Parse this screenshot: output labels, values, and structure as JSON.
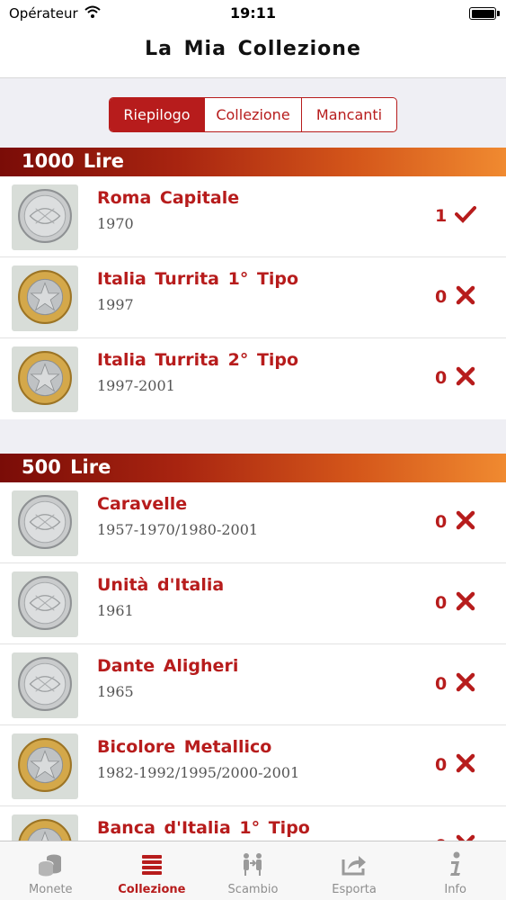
{
  "status_bar": {
    "carrier": "Opérateur",
    "time": "19:11"
  },
  "nav": {
    "title": "La Mia Collezione"
  },
  "segments": [
    {
      "label": "Riepilogo",
      "active": true
    },
    {
      "label": "Collezione",
      "active": false
    },
    {
      "label": "Mancanti",
      "active": false
    }
  ],
  "sections": [
    {
      "title": "1000 Lire",
      "items": [
        {
          "name": "Roma Capitale",
          "years": "1970",
          "count": "1",
          "owned": true,
          "icon": "silver-coin-icon"
        },
        {
          "name": "Italia Turrita 1° Tipo",
          "years": "1997",
          "count": "0",
          "owned": false,
          "icon": "bimetal-coin-icon"
        },
        {
          "name": "Italia Turrita 2° Tipo",
          "years": "1997-2001",
          "count": "0",
          "owned": false,
          "icon": "bimetal-coin-icon"
        }
      ]
    },
    {
      "title": "500 Lire",
      "items": [
        {
          "name": "Caravelle",
          "years": "1957-1970/1980-2001",
          "count": "0",
          "owned": false,
          "icon": "silver-coin-icon"
        },
        {
          "name": "Unità d'Italia",
          "years": "1961",
          "count": "0",
          "owned": false,
          "icon": "silver-coin-icon"
        },
        {
          "name": "Dante Aligheri",
          "years": "1965",
          "count": "0",
          "owned": false,
          "icon": "silver-coin-icon"
        },
        {
          "name": "Bicolore Metallico",
          "years": "1982-1992/1995/2000-2001",
          "count": "0",
          "owned": false,
          "icon": "bimetal-coin-icon"
        },
        {
          "name": "Banca d'Italia 1° Tipo",
          "years": "",
          "count": "0",
          "owned": false,
          "icon": "bimetal-coin-icon"
        }
      ]
    }
  ],
  "tabs": [
    {
      "label": "Monete",
      "icon": "coins-stack-icon",
      "active": false
    },
    {
      "label": "Collezione",
      "icon": "collection-icon",
      "active": true
    },
    {
      "label": "Scambio",
      "icon": "exchange-icon",
      "active": false
    },
    {
      "label": "Esporta",
      "icon": "export-icon",
      "active": false
    },
    {
      "label": "Info",
      "icon": "info-icon",
      "active": false
    }
  ],
  "colors": {
    "accent": "#b71c1c",
    "header_gradient_start": "#7a0c07",
    "header_gradient_end": "#f08a30"
  }
}
